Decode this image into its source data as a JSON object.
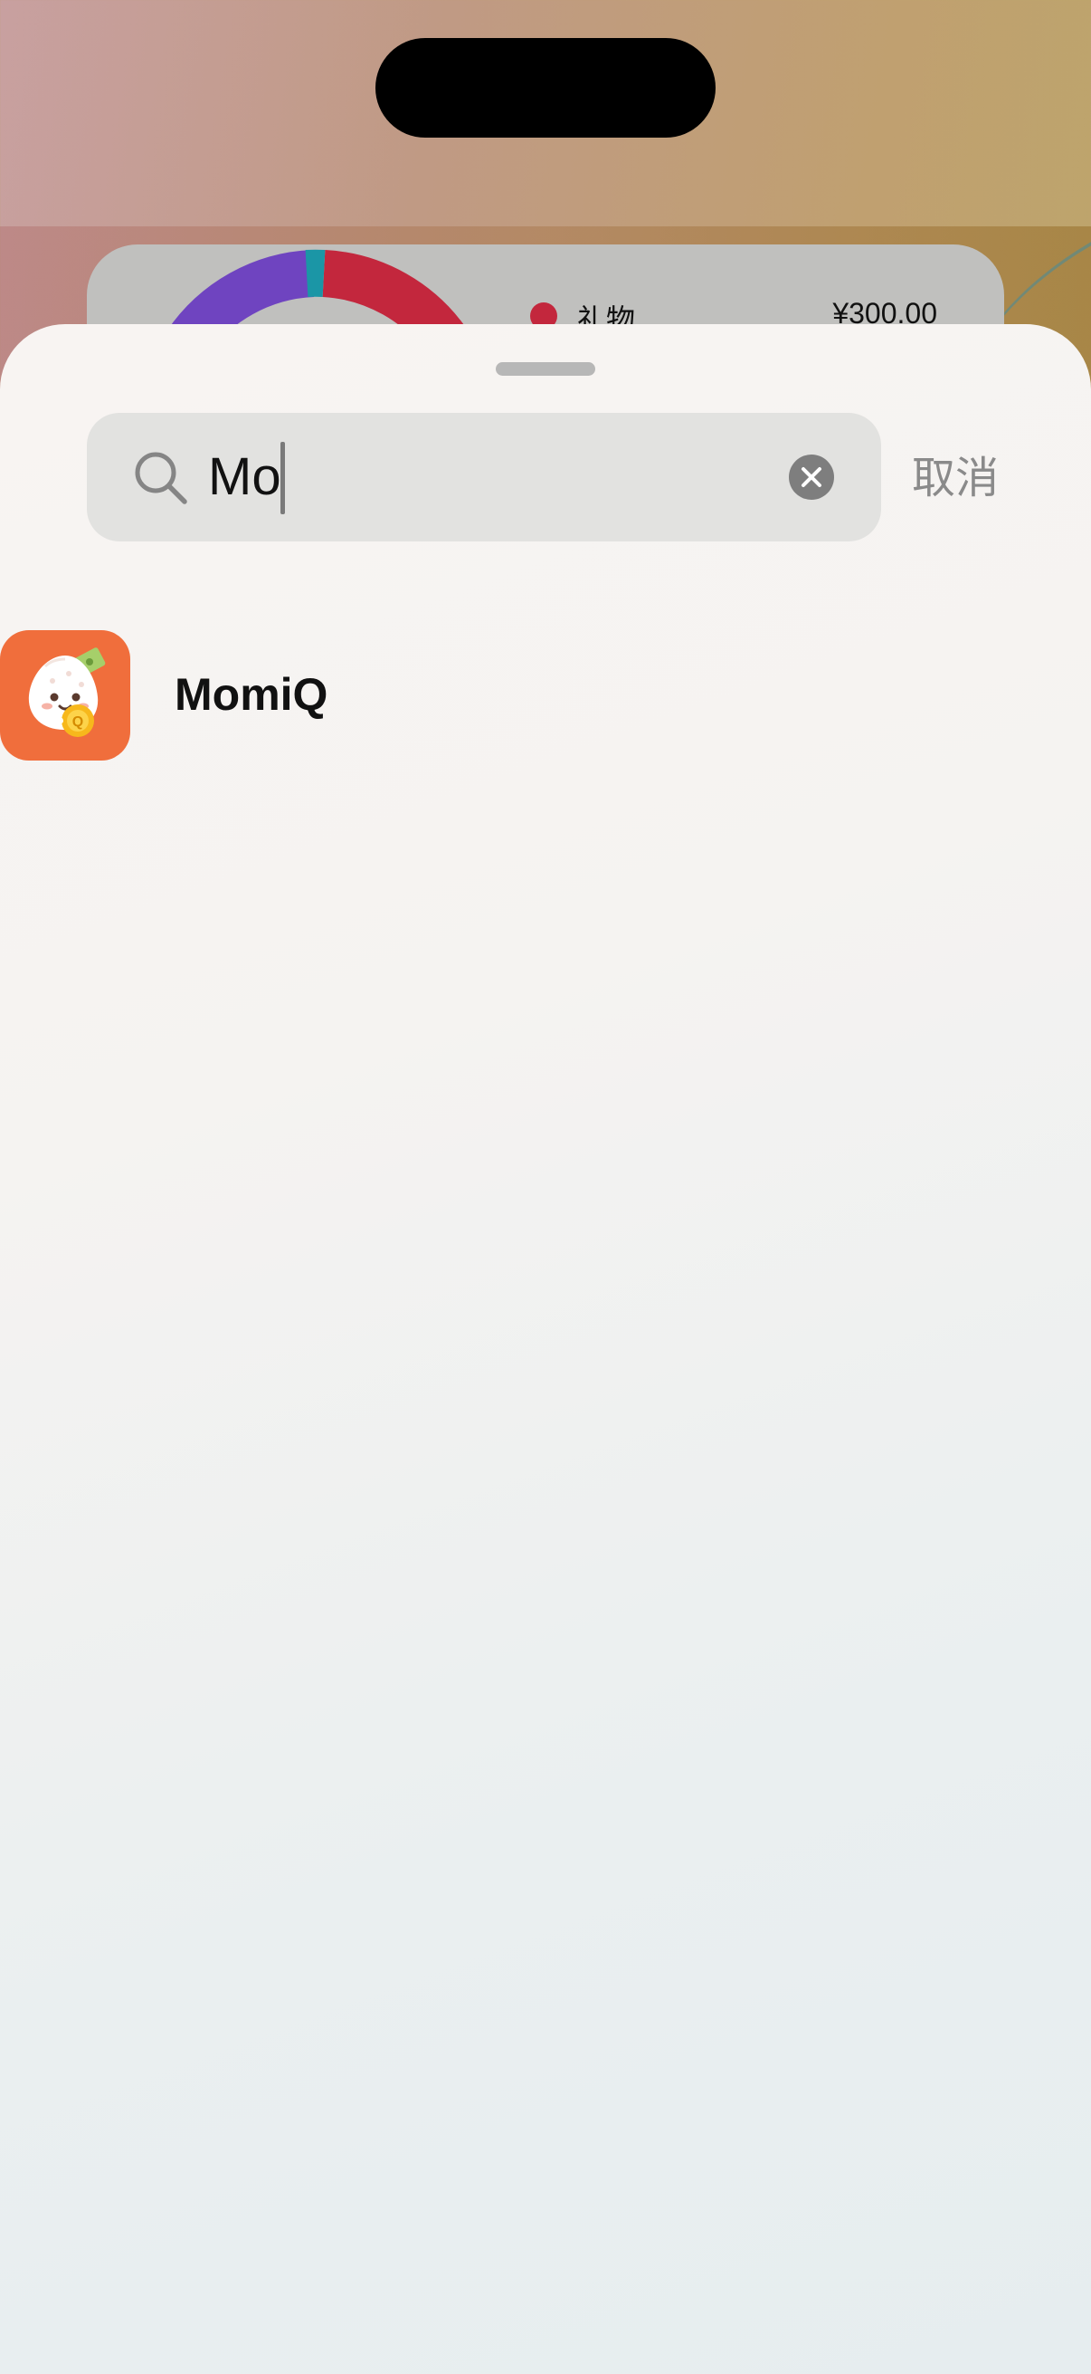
{
  "widget": {
    "legend": [
      {
        "label": "礼物",
        "value": "¥300.00",
        "color": "#c3273d"
      }
    ]
  },
  "search": {
    "query": "Mo",
    "cancel_label": "取消"
  },
  "results": [
    {
      "name": "MomiQ",
      "icon": "momiq-app-icon"
    }
  ],
  "colors": {
    "accent_orange": "#f06e3c",
    "donut_red": "#c3273d",
    "donut_purple": "#6f44c0",
    "donut_teal": "#1b96a6"
  }
}
